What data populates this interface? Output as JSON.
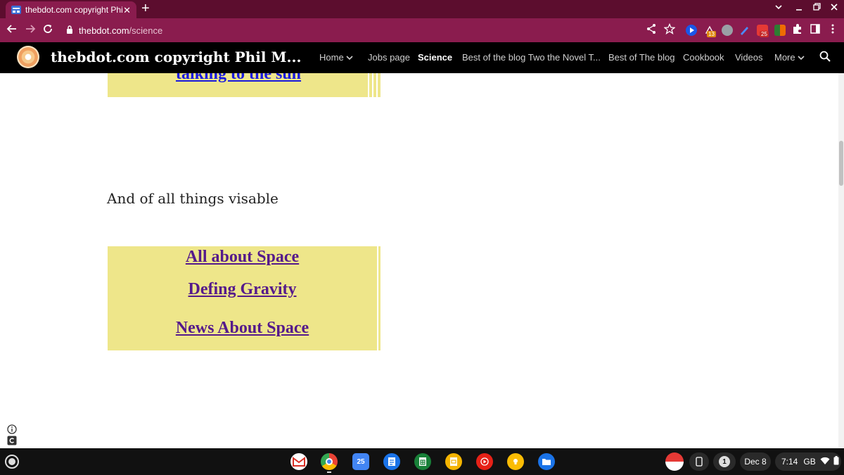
{
  "browser": {
    "tab_title": "thebdot.com copyright Phil Mus",
    "tab_close": "✕",
    "new_tab": "+",
    "url_domain": "thebdot.com",
    "url_path": "/science",
    "extensions": {
      "badge_1": "13",
      "badge_2": "25"
    }
  },
  "site": {
    "title": "thebdot.com copyright Phil M...",
    "menu": [
      {
        "label": "Home"
      },
      {
        "label": "Jobs page"
      },
      {
        "label": "Science"
      },
      {
        "label": "Best of the blog Two the Novel T..."
      },
      {
        "label": "Best of The blog"
      },
      {
        "label": "Cookbook"
      },
      {
        "label": "Videos"
      },
      {
        "label": "More"
      }
    ]
  },
  "content": {
    "top_link": "talking to the sun",
    "section_heading": "And of all things visable",
    "links": [
      {
        "label": "All about Space"
      },
      {
        "label": "Defing Gravity"
      },
      {
        "label": "News About Space"
      }
    ]
  },
  "shelf": {
    "calendar_day": "25",
    "notification_count": "1",
    "date": "Dec 8",
    "time": "7:14",
    "locale": "GB"
  },
  "colors": {
    "tab_strip": "#5c0d2e",
    "toolbar": "#8a1c4e",
    "header": "#000000",
    "link_box": "#eee68a",
    "visited_link": "#551a8b"
  }
}
